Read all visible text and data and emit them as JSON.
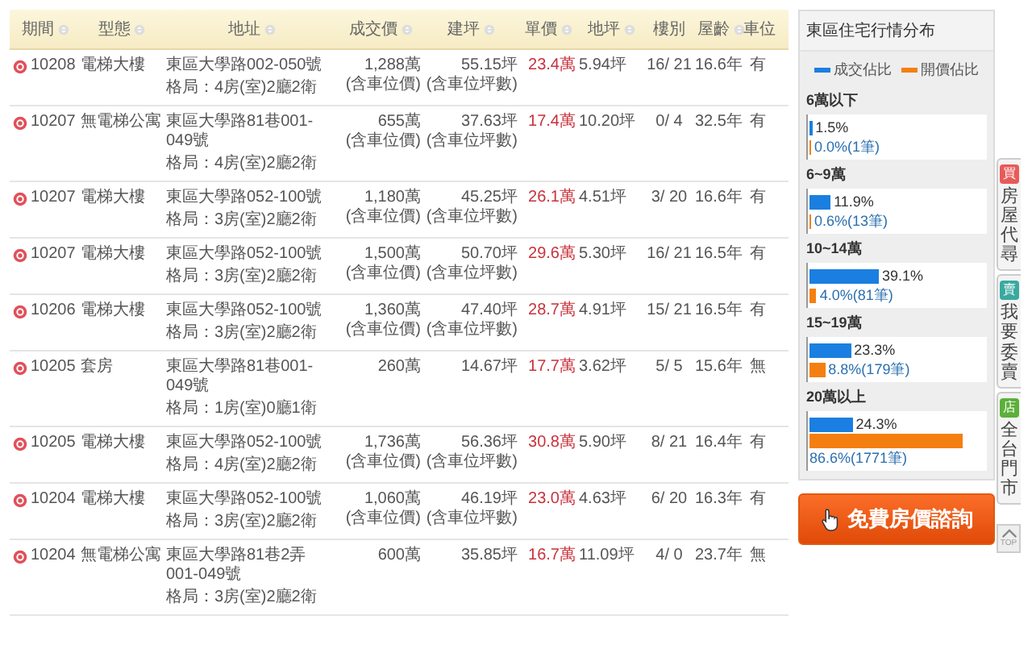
{
  "table": {
    "columns": [
      {
        "label": "期間",
        "sortable": true
      },
      {
        "label": "型態",
        "sortable": true
      },
      {
        "label": "地址",
        "sortable": true
      },
      {
        "label": "成交價",
        "sortable": true
      },
      {
        "label": "建坪",
        "sortable": true
      },
      {
        "label": "單價",
        "sortable": true
      },
      {
        "label": "地坪",
        "sortable": true
      },
      {
        "label": "樓別",
        "sortable": false
      },
      {
        "label": "屋齡",
        "sortable": true
      },
      {
        "label": "車位",
        "sortable": false
      }
    ],
    "rows": [
      {
        "period": "10208",
        "type": "電梯大樓",
        "address": "東區大學路002-050號",
        "layout": "格局：4房(室)2廳2衛",
        "price": "1,288萬",
        "price_note": "(含車位價)",
        "area": "55.15坪",
        "area_note": "(含車位坪數)",
        "unit_price": "23.4萬",
        "land": "5.94坪",
        "floor": "16/ 21",
        "age": "16.6年",
        "parking": "有"
      },
      {
        "period": "10207",
        "type": "無電梯公寓",
        "address": "東區大學路81巷001-049號",
        "layout": "格局：4房(室)2廳2衛",
        "price": "655萬",
        "price_note": "(含車位價)",
        "area": "37.63坪",
        "area_note": "(含車位坪數)",
        "unit_price": "17.4萬",
        "land": "10.20坪",
        "floor": "0/ 4",
        "age": "32.5年",
        "parking": "有"
      },
      {
        "period": "10207",
        "type": "電梯大樓",
        "address": "東區大學路052-100號",
        "layout": "格局：3房(室)2廳2衛",
        "price": "1,180萬",
        "price_note": "(含車位價)",
        "area": "45.25坪",
        "area_note": "(含車位坪數)",
        "unit_price": "26.1萬",
        "land": "4.51坪",
        "floor": "3/ 20",
        "age": "16.6年",
        "parking": "有"
      },
      {
        "period": "10207",
        "type": "電梯大樓",
        "address": "東區大學路052-100號",
        "layout": "格局：3房(室)2廳2衛",
        "price": "1,500萬",
        "price_note": "(含車位價)",
        "area": "50.70坪",
        "area_note": "(含車位坪數)",
        "unit_price": "29.6萬",
        "land": "5.30坪",
        "floor": "16/ 21",
        "age": "16.5年",
        "parking": "有"
      },
      {
        "period": "10206",
        "type": "電梯大樓",
        "address": "東區大學路052-100號",
        "layout": "格局：3房(室)2廳2衛",
        "price": "1,360萬",
        "price_note": "(含車位價)",
        "area": "47.40坪",
        "area_note": "(含車位坪數)",
        "unit_price": "28.7萬",
        "land": "4.91坪",
        "floor": "15/ 21",
        "age": "16.5年",
        "parking": "有"
      },
      {
        "period": "10205",
        "type": "套房",
        "address": "東區大學路81巷001-049號",
        "layout": "格局：1房(室)0廳1衛",
        "price": "260萬",
        "area": "14.67坪",
        "unit_price": "17.7萬",
        "land": "3.62坪",
        "floor": "5/ 5",
        "age": "15.6年",
        "parking": "無"
      },
      {
        "period": "10205",
        "type": "電梯大樓",
        "address": "東區大學路052-100號",
        "layout": "格局：4房(室)2廳2衛",
        "price": "1,736萬",
        "price_note": "(含車位價)",
        "area": "56.36坪",
        "area_note": "(含車位坪數)",
        "unit_price": "30.8萬",
        "land": "5.90坪",
        "floor": "8/ 21",
        "age": "16.4年",
        "parking": "有"
      },
      {
        "period": "10204",
        "type": "電梯大樓",
        "address": "東區大學路052-100號",
        "layout": "格局：3房(室)2廳2衛",
        "price": "1,060萬",
        "price_note": "(含車位價)",
        "area": "46.19坪",
        "area_note": "(含車位坪數)",
        "unit_price": "23.0萬",
        "land": "4.63坪",
        "floor": "6/ 20",
        "age": "16.3年",
        "parking": "有"
      },
      {
        "period": "10204",
        "type": "無電梯公寓",
        "address": "東區大學路81巷2弄001-049號",
        "layout": "格局：3房(室)2廳2衛",
        "price": "600萬",
        "area": "35.85坪",
        "unit_price": "16.7萬",
        "land": "11.09坪",
        "floor": "4/ 0",
        "age": "23.7年",
        "parking": "無"
      }
    ]
  },
  "distribution": {
    "title": "東區住宅行情分布",
    "legend": [
      {
        "label": "成交佔比",
        "color": "#1a7fe0"
      },
      {
        "label": "開價佔比",
        "color": "#f47f10"
      }
    ],
    "groups": [
      {
        "label": "6萬以下",
        "deal": {
          "level": 0.015,
          "text": "1.5%"
        },
        "ask": {
          "level": 0.0,
          "text": "0.0%(1筆)"
        }
      },
      {
        "label": "6~9萬",
        "deal": {
          "level": 0.119,
          "text": "11.9%"
        },
        "ask": {
          "level": 0.006,
          "text": "0.6%(13筆)"
        }
      },
      {
        "label": "10~14萬",
        "deal": {
          "level": 0.391,
          "text": "39.1%"
        },
        "ask": {
          "level": 0.04,
          "text": "4.0%(81筆)"
        }
      },
      {
        "label": "15~19萬",
        "deal": {
          "level": 0.233,
          "text": "23.3%"
        },
        "ask": {
          "level": 0.088,
          "text": "8.8%(179筆)"
        }
      },
      {
        "label": "20萬以上",
        "deal": {
          "level": 0.243,
          "text": "24.3%"
        },
        "ask": {
          "level": 0.866,
          "text": "86.6%(1771筆)"
        }
      }
    ]
  },
  "consult_button": "免費房價諮詢",
  "side_tabs": [
    {
      "badge": "買",
      "label": "房屋代尋",
      "color": "#e85a5a"
    },
    {
      "badge": "賣",
      "label": "我要委賣",
      "color": "#3aa9a0"
    },
    {
      "badge": "店",
      "label": "全台門市",
      "color": "#5cb03a"
    }
  ],
  "top_button": "TOP"
}
